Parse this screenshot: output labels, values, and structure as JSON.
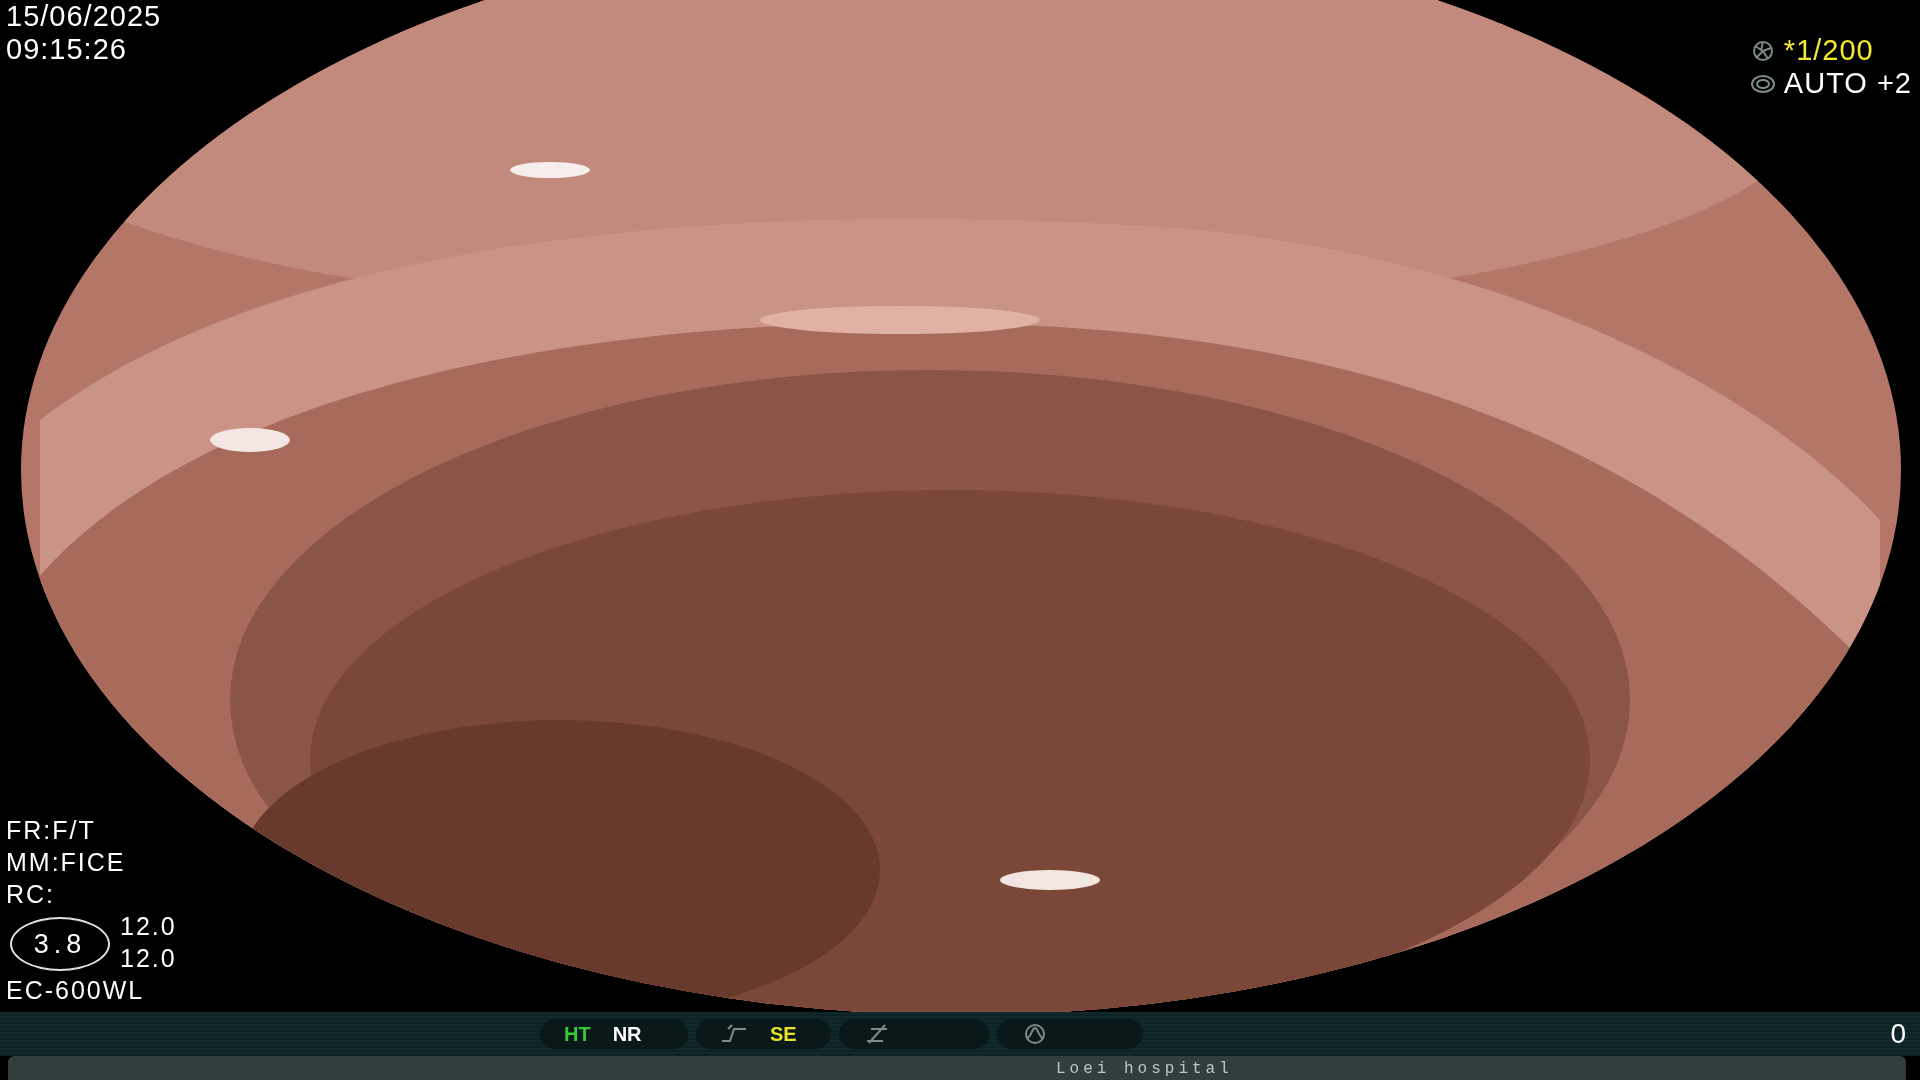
{
  "overlay": {
    "date": "15/06/2025",
    "time": "09:15:26"
  },
  "exposure": [
    {
      "kind": "shutter",
      "text": "*1/200",
      "color": "#f2ea2c"
    },
    {
      "kind": "iris",
      "text": "AUTO +2",
      "color": "#ffffff"
    }
  ],
  "settings": [
    "FR:F/T",
    "MM:FICE",
    "RC:"
  ],
  "gauge": {
    "value": "3.8",
    "readings": [
      "12.0",
      "12.0"
    ]
  },
  "scope": "EC-600WL",
  "status_bar": {
    "groups": [
      {
        "items": [
          {
            "kind": "text",
            "text": "HT",
            "color": "#38c838"
          },
          {
            "kind": "text",
            "text": "NR",
            "color": "#ffffff"
          }
        ]
      },
      {
        "items": [
          {
            "kind": "step"
          },
          {
            "kind": "text",
            "text": "SE",
            "color": "#e8e02a"
          }
        ]
      },
      {
        "items": [
          {
            "kind": "slope"
          }
        ]
      },
      {
        "items": [
          {
            "kind": "peak"
          }
        ]
      }
    ],
    "counter": "0"
  },
  "footer": "Loei hospital"
}
